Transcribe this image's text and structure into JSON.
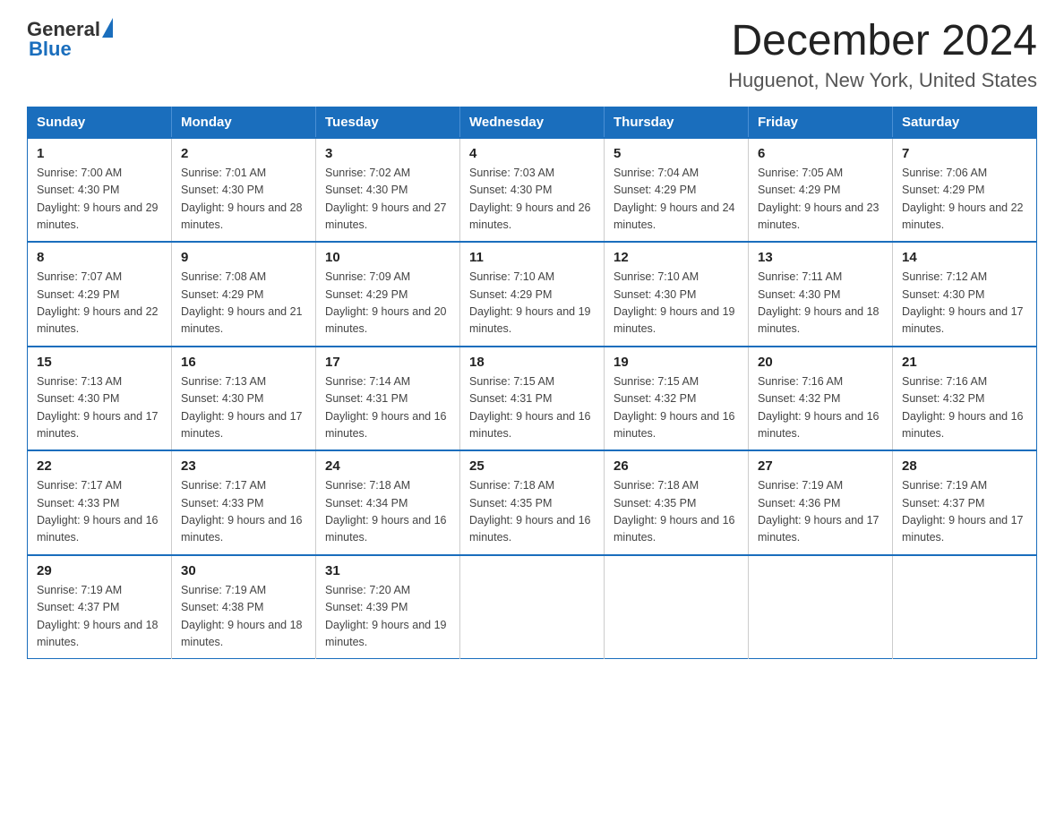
{
  "header": {
    "logo_text_general": "General",
    "logo_text_blue": "Blue",
    "title": "December 2024",
    "subtitle": "Huguenot, New York, United States"
  },
  "calendar": {
    "days_of_week": [
      "Sunday",
      "Monday",
      "Tuesday",
      "Wednesday",
      "Thursday",
      "Friday",
      "Saturday"
    ],
    "weeks": [
      [
        {
          "day": "1",
          "sunrise": "7:00 AM",
          "sunset": "4:30 PM",
          "daylight": "9 hours and 29 minutes."
        },
        {
          "day": "2",
          "sunrise": "7:01 AM",
          "sunset": "4:30 PM",
          "daylight": "9 hours and 28 minutes."
        },
        {
          "day": "3",
          "sunrise": "7:02 AM",
          "sunset": "4:30 PM",
          "daylight": "9 hours and 27 minutes."
        },
        {
          "day": "4",
          "sunrise": "7:03 AM",
          "sunset": "4:30 PM",
          "daylight": "9 hours and 26 minutes."
        },
        {
          "day": "5",
          "sunrise": "7:04 AM",
          "sunset": "4:29 PM",
          "daylight": "9 hours and 24 minutes."
        },
        {
          "day": "6",
          "sunrise": "7:05 AM",
          "sunset": "4:29 PM",
          "daylight": "9 hours and 23 minutes."
        },
        {
          "day": "7",
          "sunrise": "7:06 AM",
          "sunset": "4:29 PM",
          "daylight": "9 hours and 22 minutes."
        }
      ],
      [
        {
          "day": "8",
          "sunrise": "7:07 AM",
          "sunset": "4:29 PM",
          "daylight": "9 hours and 22 minutes."
        },
        {
          "day": "9",
          "sunrise": "7:08 AM",
          "sunset": "4:29 PM",
          "daylight": "9 hours and 21 minutes."
        },
        {
          "day": "10",
          "sunrise": "7:09 AM",
          "sunset": "4:29 PM",
          "daylight": "9 hours and 20 minutes."
        },
        {
          "day": "11",
          "sunrise": "7:10 AM",
          "sunset": "4:29 PM",
          "daylight": "9 hours and 19 minutes."
        },
        {
          "day": "12",
          "sunrise": "7:10 AM",
          "sunset": "4:30 PM",
          "daylight": "9 hours and 19 minutes."
        },
        {
          "day": "13",
          "sunrise": "7:11 AM",
          "sunset": "4:30 PM",
          "daylight": "9 hours and 18 minutes."
        },
        {
          "day": "14",
          "sunrise": "7:12 AM",
          "sunset": "4:30 PM",
          "daylight": "9 hours and 17 minutes."
        }
      ],
      [
        {
          "day": "15",
          "sunrise": "7:13 AM",
          "sunset": "4:30 PM",
          "daylight": "9 hours and 17 minutes."
        },
        {
          "day": "16",
          "sunrise": "7:13 AM",
          "sunset": "4:30 PM",
          "daylight": "9 hours and 17 minutes."
        },
        {
          "day": "17",
          "sunrise": "7:14 AM",
          "sunset": "4:31 PM",
          "daylight": "9 hours and 16 minutes."
        },
        {
          "day": "18",
          "sunrise": "7:15 AM",
          "sunset": "4:31 PM",
          "daylight": "9 hours and 16 minutes."
        },
        {
          "day": "19",
          "sunrise": "7:15 AM",
          "sunset": "4:32 PM",
          "daylight": "9 hours and 16 minutes."
        },
        {
          "day": "20",
          "sunrise": "7:16 AM",
          "sunset": "4:32 PM",
          "daylight": "9 hours and 16 minutes."
        },
        {
          "day": "21",
          "sunrise": "7:16 AM",
          "sunset": "4:32 PM",
          "daylight": "9 hours and 16 minutes."
        }
      ],
      [
        {
          "day": "22",
          "sunrise": "7:17 AM",
          "sunset": "4:33 PM",
          "daylight": "9 hours and 16 minutes."
        },
        {
          "day": "23",
          "sunrise": "7:17 AM",
          "sunset": "4:33 PM",
          "daylight": "9 hours and 16 minutes."
        },
        {
          "day": "24",
          "sunrise": "7:18 AM",
          "sunset": "4:34 PM",
          "daylight": "9 hours and 16 minutes."
        },
        {
          "day": "25",
          "sunrise": "7:18 AM",
          "sunset": "4:35 PM",
          "daylight": "9 hours and 16 minutes."
        },
        {
          "day": "26",
          "sunrise": "7:18 AM",
          "sunset": "4:35 PM",
          "daylight": "9 hours and 16 minutes."
        },
        {
          "day": "27",
          "sunrise": "7:19 AM",
          "sunset": "4:36 PM",
          "daylight": "9 hours and 17 minutes."
        },
        {
          "day": "28",
          "sunrise": "7:19 AM",
          "sunset": "4:37 PM",
          "daylight": "9 hours and 17 minutes."
        }
      ],
      [
        {
          "day": "29",
          "sunrise": "7:19 AM",
          "sunset": "4:37 PM",
          "daylight": "9 hours and 18 minutes."
        },
        {
          "day": "30",
          "sunrise": "7:19 AM",
          "sunset": "4:38 PM",
          "daylight": "9 hours and 18 minutes."
        },
        {
          "day": "31",
          "sunrise": "7:20 AM",
          "sunset": "4:39 PM",
          "daylight": "9 hours and 19 minutes."
        },
        null,
        null,
        null,
        null
      ]
    ]
  }
}
